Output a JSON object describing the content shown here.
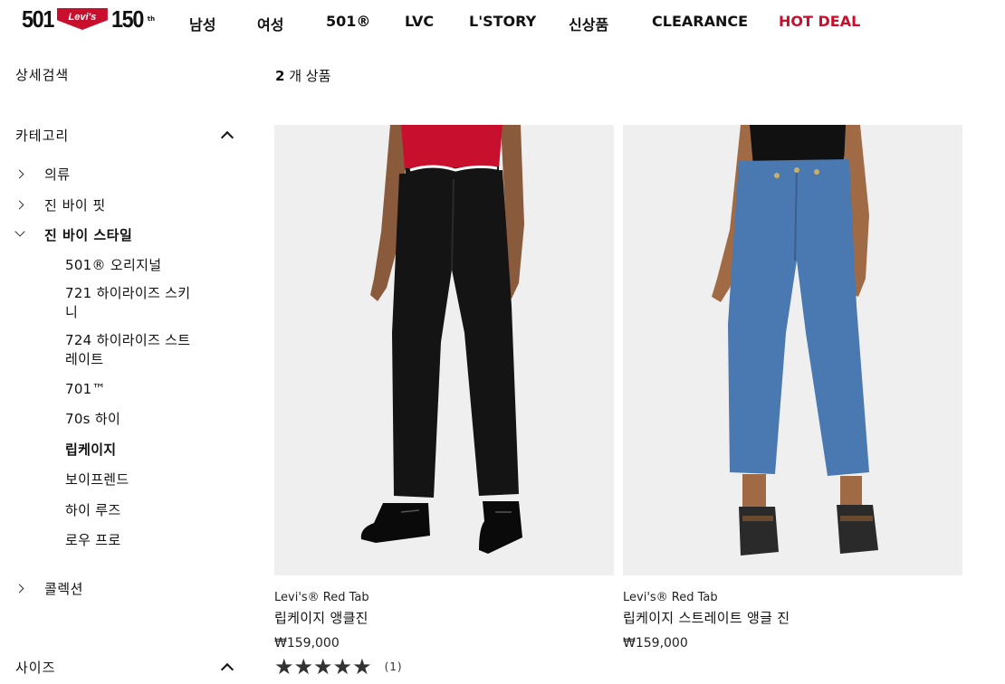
{
  "header": {
    "logo": {
      "left_number": "501",
      "brand": "Levi's",
      "right_number": "150",
      "tm": "th"
    },
    "nav": [
      {
        "label": "남성",
        "name": "nav-men"
      },
      {
        "label": "여성",
        "name": "nav-women"
      },
      {
        "label": "501®",
        "name": "nav-501"
      },
      {
        "label": "LVC",
        "name": "nav-lvc"
      },
      {
        "label": "L'STORY",
        "name": "nav-lstory"
      },
      {
        "label": "신상품",
        "name": "nav-new"
      },
      {
        "label": "CLEARANCE",
        "name": "nav-clearance"
      },
      {
        "label": "HOT DEAL",
        "name": "nav-hot-deal",
        "color": "#c8102e"
      }
    ]
  },
  "sidebar": {
    "title": "상세검색",
    "category_title": "카테고리",
    "categories": [
      {
        "label": "의류",
        "expanded": false
      },
      {
        "label": "진 바이 핏",
        "expanded": false
      },
      {
        "label": "진 바이 스타일",
        "expanded": true
      },
      {
        "label": "콜렉션",
        "expanded": false
      }
    ],
    "style_items": [
      {
        "label": "501® 오리지널",
        "selected": false
      },
      {
        "label": "721 하이라이즈 스키니",
        "selected": false
      },
      {
        "label": "724 하이라이즈 스트레이트",
        "selected": false
      },
      {
        "label": "701™",
        "selected": false
      },
      {
        "label": "70s 하이",
        "selected": false
      },
      {
        "label": "립케이지",
        "selected": true
      },
      {
        "label": "보이프렌드",
        "selected": false
      },
      {
        "label": "하이 루즈",
        "selected": false
      },
      {
        "label": "로우 프로",
        "selected": false
      }
    ],
    "size_title": "사이즈"
  },
  "main": {
    "result_count": "2",
    "result_suffix": "개 상품",
    "products": [
      {
        "brand": "Levi's® Red Tab",
        "name": "립케이지 앵클진",
        "price": "₩159,000",
        "rating": 5,
        "review_count": "(1)",
        "image": "black-jeans-model",
        "jeans_color": "#141414",
        "top_color": "#c8102e"
      },
      {
        "brand": "Levi's® Red Tab",
        "name": "립케이지 스트레이트 앵글 진",
        "price": "₩159,000",
        "image": "blue-jeans-model",
        "jeans_color": "#4a78b0",
        "top_color": "#111111"
      }
    ]
  },
  "colors": {
    "accent": "#c8102e",
    "text": "#111111",
    "image_bg": "#efefef"
  }
}
